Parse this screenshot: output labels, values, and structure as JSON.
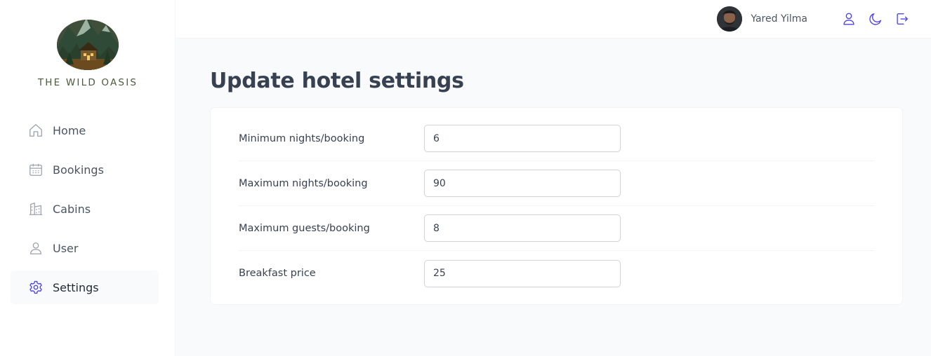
{
  "brand": {
    "name": "THE WILD OASIS"
  },
  "sidebar": {
    "items": [
      {
        "label": "Home",
        "icon": "home-icon"
      },
      {
        "label": "Bookings",
        "icon": "calendar-icon"
      },
      {
        "label": "Cabins",
        "icon": "building-icon"
      },
      {
        "label": "User",
        "icon": "user-icon"
      },
      {
        "label": "Settings",
        "icon": "gear-icon",
        "active": true
      }
    ]
  },
  "header": {
    "user_name": "Yared Yilma",
    "icons": [
      "user-icon",
      "moon-icon",
      "logout-icon"
    ]
  },
  "main": {
    "title": "Update hotel settings",
    "settings": [
      {
        "label": "Minimum nights/booking",
        "value": "6"
      },
      {
        "label": "Maximum nights/booking",
        "value": "90"
      },
      {
        "label": "Maximum guests/booking",
        "value": "8"
      },
      {
        "label": "Breakfast price",
        "value": "25"
      }
    ]
  },
  "colors": {
    "accent": "#4f46e5",
    "icon_gray": "#9ca3af",
    "background": "#f9fafb"
  }
}
